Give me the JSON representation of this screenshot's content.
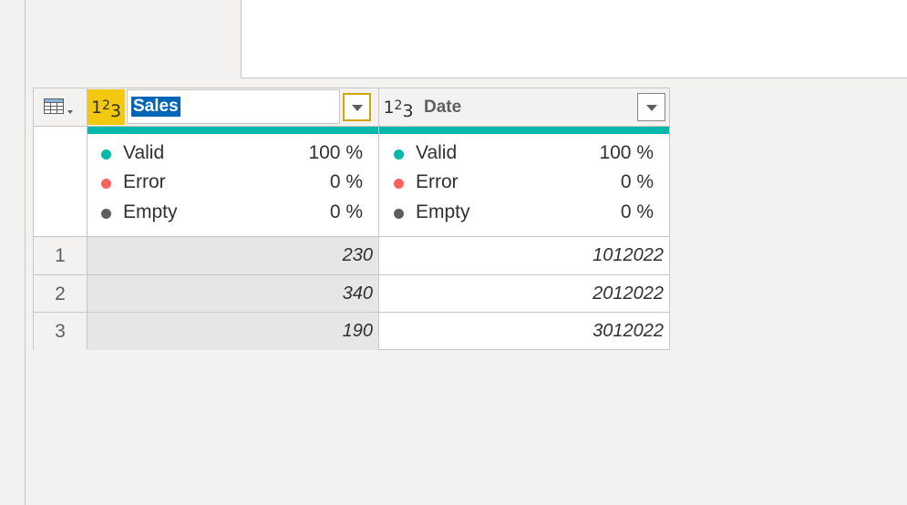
{
  "columns": [
    {
      "type_icon": "123",
      "name": "Sales",
      "selected": true,
      "quality": {
        "valid_label": "Valid",
        "valid": "100 %",
        "error_label": "Error",
        "error": "0 %",
        "empty_label": "Empty",
        "empty": "0 %"
      }
    },
    {
      "type_icon": "123",
      "name": "Date",
      "selected": false,
      "quality": {
        "valid_label": "Valid",
        "valid": "100 %",
        "error_label": "Error",
        "error": "0 %",
        "empty_label": "Empty",
        "empty": "0 %"
      }
    }
  ],
  "rows": [
    {
      "num": "1",
      "sales": "230",
      "date": "1012022"
    },
    {
      "num": "2",
      "sales": "340",
      "date": "2012022"
    },
    {
      "num": "3",
      "sales": "190",
      "date": "3012022"
    }
  ],
  "colors": {
    "valid": "#01b8aa",
    "error": "#fd625e",
    "empty": "#605e5c",
    "active_type": "#f2c811",
    "selection": "#0067b8"
  }
}
